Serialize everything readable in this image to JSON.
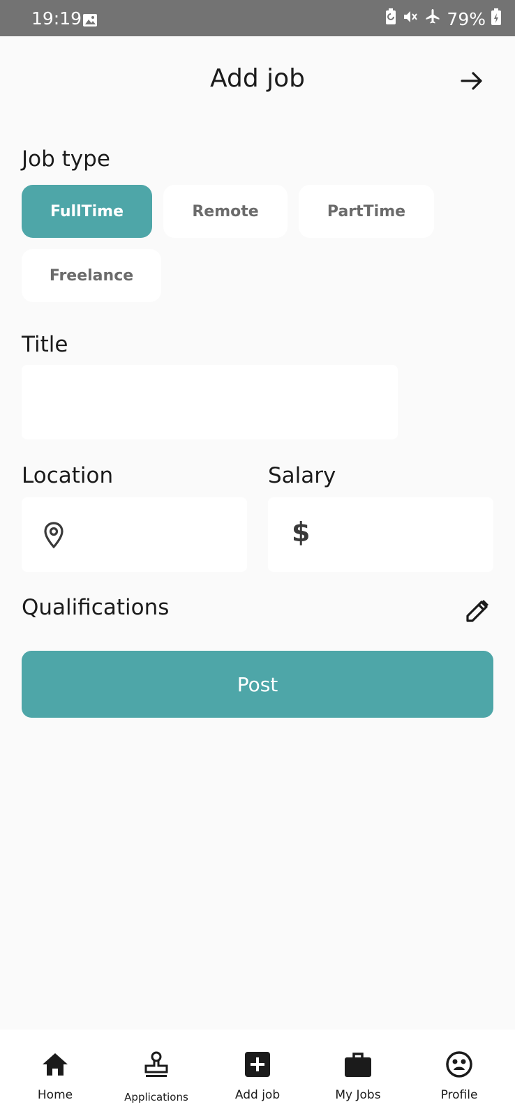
{
  "status_bar": {
    "time": "19:19",
    "battery": "79%"
  },
  "header": {
    "title": "Add job"
  },
  "job_type": {
    "label": "Job type",
    "options": [
      "FullTime",
      "Remote",
      "PartTime",
      "Freelance"
    ],
    "selected": "FullTime"
  },
  "title_field": {
    "label": "Title",
    "value": ""
  },
  "location_field": {
    "label": "Location",
    "value": "",
    "icon": "location-pin-icon"
  },
  "salary_field": {
    "label": "Salary",
    "value": "",
    "icon": "dollar-icon",
    "symbol": "$"
  },
  "qualifications": {
    "label": "Qualifications",
    "icon": "pencil-icon"
  },
  "post_button": {
    "label": "Post"
  },
  "colors": {
    "accent": "#4ea6a8",
    "background": "#fafafa",
    "status_bar": "#737373"
  },
  "bottom_nav": {
    "items": [
      {
        "label": "Home",
        "icon": "home-icon"
      },
      {
        "label": "Applications",
        "icon": "stamp-icon"
      },
      {
        "label": "Add job",
        "icon": "add-box-icon"
      },
      {
        "label": "My Jobs",
        "icon": "briefcase-icon"
      },
      {
        "label": "Profile",
        "icon": "profile-face-icon"
      }
    ]
  }
}
